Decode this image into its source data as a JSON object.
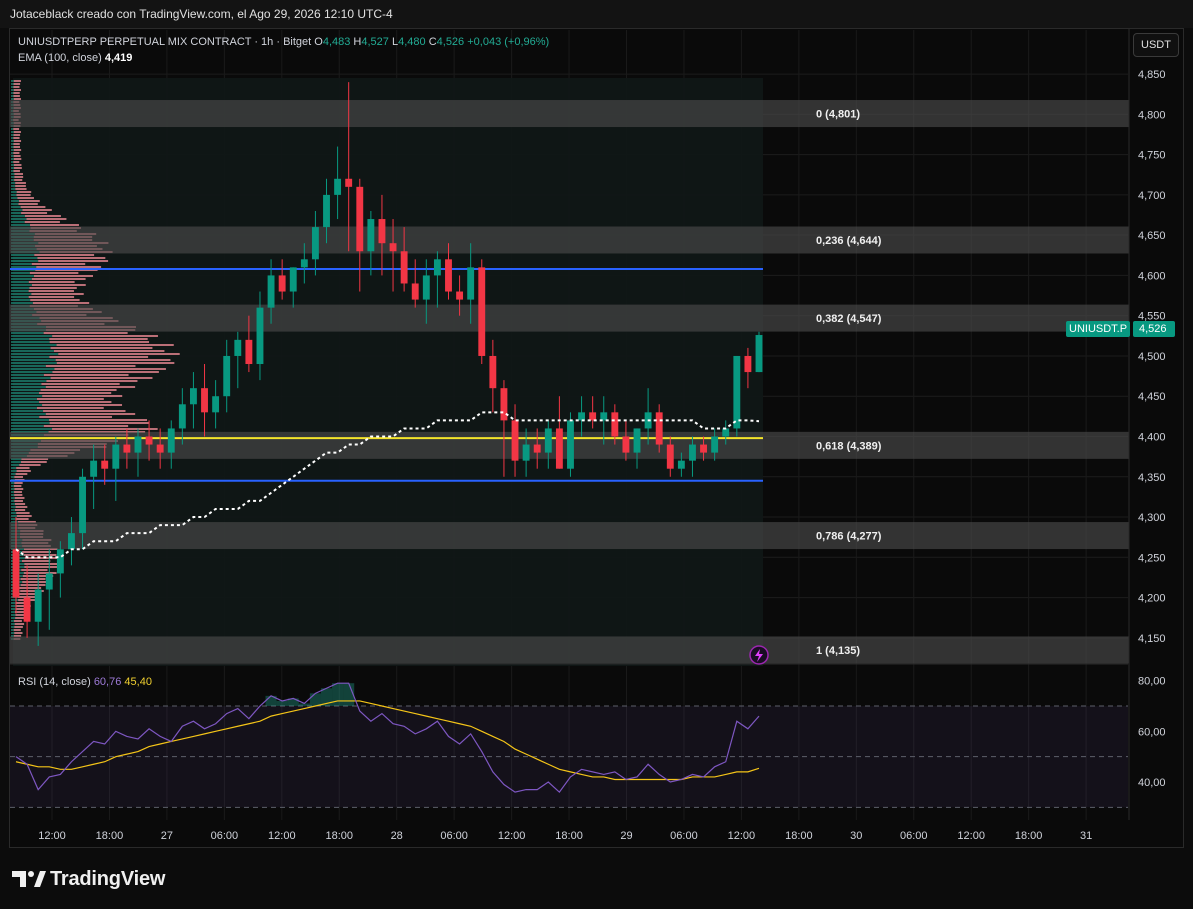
{
  "header": {
    "caption": "Jotaceblack creado con TradingView.com, el Ago 29, 2026 12:10 UTC-4"
  },
  "legend": {
    "symbol": "UNIUSDTPERP PERPETUAL MIX CONTRACT · 1h · Bitget",
    "o_label": "O",
    "o_value": "4,483",
    "h_label": "H",
    "h_value": "4,527",
    "l_label": "L",
    "l_value": "4,480",
    "c_label": "C",
    "c_value": "4,526",
    "change": "+0,043 (+0,96%)",
    "ema_label": "EMA (100, close)",
    "ema_value": "4,419",
    "rsi_label": "RSI (14, close)",
    "rsi_value": "60,76",
    "rsi_ma_value": "45,40"
  },
  "currency_button": "USDT",
  "price_tag": {
    "symbol": "UNIUSDT.P",
    "value": "4,526"
  },
  "branding": "TradingView",
  "colors": {
    "up": "#089981",
    "down": "#f23645",
    "ema": "#ffffff",
    "fib_band": "#4a4a4a",
    "support_line": "#2962ff",
    "poc_line": "#f5e52b",
    "rsi": "#7e57c2",
    "rsi_ma": "#f5c518",
    "volume_profile": "#f48d98",
    "volume_profile_up": "#1e8a78"
  },
  "chart_data": [
    {
      "type": "candlestick",
      "title": "UNIUSDTPERP PERPETUAL MIX CONTRACT · 1h · Bitget",
      "x_tick_labels": [
        "12:00",
        "18:00",
        "27",
        "06:00",
        "12:00",
        "18:00",
        "28",
        "06:00",
        "12:00",
        "18:00",
        "29",
        "06:00",
        "12:00",
        "18:00",
        "30",
        "06:00",
        "12:00",
        "18:00",
        "31"
      ],
      "y_tick_labels": [
        "4,850",
        "4,800",
        "4,750",
        "4,700",
        "4,650",
        "4,600",
        "4,550",
        "4,500",
        "4,450",
        "4,400",
        "4,350",
        "4,300",
        "4,250",
        "4,200",
        "4,150"
      ],
      "ylim": [
        4.12,
        4.865
      ],
      "candles_ohlc": [
        [
          4.26,
          4.3,
          4.18,
          4.2
        ],
        [
          4.2,
          4.24,
          4.15,
          4.17
        ],
        [
          4.17,
          4.23,
          4.14,
          4.21
        ],
        [
          4.21,
          4.26,
          4.16,
          4.23
        ],
        [
          4.23,
          4.27,
          4.2,
          4.26
        ],
        [
          4.26,
          4.3,
          4.24,
          4.28
        ],
        [
          4.28,
          4.36,
          4.26,
          4.35
        ],
        [
          4.35,
          4.39,
          4.31,
          4.37
        ],
        [
          4.37,
          4.39,
          4.34,
          4.36
        ],
        [
          4.36,
          4.4,
          4.32,
          4.39
        ],
        [
          4.39,
          4.41,
          4.36,
          4.38
        ],
        [
          4.38,
          4.41,
          4.35,
          4.4
        ],
        [
          4.4,
          4.42,
          4.37,
          4.39
        ],
        [
          4.39,
          4.41,
          4.36,
          4.38
        ],
        [
          4.38,
          4.42,
          4.36,
          4.41
        ],
        [
          4.41,
          4.46,
          4.39,
          4.44
        ],
        [
          4.44,
          4.48,
          4.41,
          4.46
        ],
        [
          4.46,
          4.49,
          4.4,
          4.43
        ],
        [
          4.43,
          4.47,
          4.41,
          4.45
        ],
        [
          4.45,
          4.52,
          4.43,
          4.5
        ],
        [
          4.5,
          4.53,
          4.46,
          4.52
        ],
        [
          4.52,
          4.55,
          4.48,
          4.49
        ],
        [
          4.49,
          4.58,
          4.47,
          4.56
        ],
        [
          4.56,
          4.62,
          4.54,
          4.6
        ],
        [
          4.6,
          4.62,
          4.57,
          4.58
        ],
        [
          4.58,
          4.61,
          4.56,
          4.61
        ],
        [
          4.61,
          4.64,
          4.59,
          4.62
        ],
        [
          4.62,
          4.68,
          4.6,
          4.66
        ],
        [
          4.66,
          4.72,
          4.64,
          4.7
        ],
        [
          4.7,
          4.76,
          4.67,
          4.72
        ],
        [
          4.72,
          4.84,
          4.63,
          4.71
        ],
        [
          4.71,
          4.72,
          4.58,
          4.63
        ],
        [
          4.63,
          4.68,
          4.6,
          4.67
        ],
        [
          4.67,
          4.7,
          4.6,
          4.64
        ],
        [
          4.64,
          4.67,
          4.58,
          4.63
        ],
        [
          4.63,
          4.66,
          4.58,
          4.59
        ],
        [
          4.59,
          4.62,
          4.56,
          4.57
        ],
        [
          4.57,
          4.62,
          4.54,
          4.6
        ],
        [
          4.6,
          4.63,
          4.56,
          4.62
        ],
        [
          4.62,
          4.64,
          4.57,
          4.58
        ],
        [
          4.58,
          4.6,
          4.55,
          4.57
        ],
        [
          4.57,
          4.64,
          4.54,
          4.61
        ],
        [
          4.61,
          4.62,
          4.49,
          4.5
        ],
        [
          4.5,
          4.52,
          4.43,
          4.46
        ],
        [
          4.46,
          4.47,
          4.35,
          4.42
        ],
        [
          4.42,
          4.44,
          4.35,
          4.37
        ],
        [
          4.37,
          4.41,
          4.35,
          4.39
        ],
        [
          4.39,
          4.41,
          4.36,
          4.38
        ],
        [
          4.38,
          4.42,
          4.36,
          4.41
        ],
        [
          4.41,
          4.45,
          4.36,
          4.36
        ],
        [
          4.36,
          4.43,
          4.35,
          4.42
        ],
        [
          4.42,
          4.45,
          4.4,
          4.43
        ],
        [
          4.43,
          4.45,
          4.41,
          4.42
        ],
        [
          4.42,
          4.45,
          4.39,
          4.43
        ],
        [
          4.43,
          4.44,
          4.39,
          4.4
        ],
        [
          4.4,
          4.42,
          4.37,
          4.38
        ],
        [
          4.38,
          4.41,
          4.36,
          4.41
        ],
        [
          4.41,
          4.46,
          4.39,
          4.43
        ],
        [
          4.43,
          4.44,
          4.38,
          4.39
        ],
        [
          4.39,
          4.4,
          4.35,
          4.36
        ],
        [
          4.36,
          4.38,
          4.35,
          4.37
        ],
        [
          4.37,
          4.4,
          4.35,
          4.39
        ],
        [
          4.39,
          4.4,
          4.37,
          4.38
        ],
        [
          4.38,
          4.41,
          4.37,
          4.4
        ],
        [
          4.4,
          4.42,
          4.39,
          4.41
        ],
        [
          4.41,
          4.5,
          4.4,
          4.5
        ],
        [
          4.5,
          4.51,
          4.46,
          4.48
        ],
        [
          4.48,
          4.53,
          4.48,
          4.526
        ]
      ],
      "ema_100": [
        4.26,
        4.25,
        4.25,
        4.25,
        4.25,
        4.26,
        4.26,
        4.27,
        4.27,
        4.27,
        4.28,
        4.28,
        4.28,
        4.29,
        4.29,
        4.29,
        4.3,
        4.3,
        4.31,
        4.31,
        4.31,
        4.32,
        4.32,
        4.33,
        4.34,
        4.35,
        4.36,
        4.37,
        4.38,
        4.38,
        4.39,
        4.39,
        4.4,
        4.4,
        4.4,
        4.41,
        4.41,
        4.41,
        4.42,
        4.42,
        4.42,
        4.42,
        4.43,
        4.43,
        4.43,
        4.42,
        4.42,
        4.42,
        4.42,
        4.42,
        4.42,
        4.42,
        4.42,
        4.42,
        4.42,
        4.42,
        4.42,
        4.42,
        4.42,
        4.42,
        4.42,
        4.42,
        4.41,
        4.41,
        4.41,
        4.42,
        4.42,
        4.419
      ],
      "fibonacci_levels": [
        {
          "ratio": 0,
          "price": 4.801,
          "label": "0 (4,801)"
        },
        {
          "ratio": 0.236,
          "price": 4.644,
          "label": "0,236 (4,644)"
        },
        {
          "ratio": 0.382,
          "price": 4.547,
          "label": "0,382 (4,547)"
        },
        {
          "ratio": 0.618,
          "price": 4.389,
          "label": "0,618 (4,389)"
        },
        {
          "ratio": 0.786,
          "price": 4.277,
          "label": "0,786 (4,277)"
        },
        {
          "ratio": 1,
          "price": 4.135,
          "label": "1 (4,135)"
        }
      ],
      "horizontal_lines": [
        {
          "price": 4.608,
          "color": "blue"
        },
        {
          "price": 4.398,
          "color": "yellow"
        },
        {
          "price": 4.345,
          "color": "blue"
        }
      ]
    },
    {
      "type": "line",
      "title": "RSI (14, close)",
      "y_tick_labels": [
        "80,00",
        "60,00",
        "40,00"
      ],
      "ylim": [
        25,
        85
      ],
      "levels": [
        70,
        50,
        30
      ],
      "series": [
        {
          "name": "RSI",
          "values": [
            50,
            47,
            37,
            42,
            43,
            48,
            52,
            56,
            55,
            60,
            58,
            57,
            61,
            58,
            56,
            62,
            64,
            61,
            63,
            67,
            69,
            65,
            70,
            74,
            72,
            73,
            71,
            75,
            77,
            79,
            79,
            68,
            64,
            67,
            63,
            62,
            59,
            61,
            64,
            58,
            55,
            59,
            52,
            44,
            39,
            36,
            37,
            37,
            40,
            36,
            42,
            45,
            44,
            43,
            44,
            41,
            42,
            47,
            43,
            40,
            41,
            43,
            42,
            46,
            48,
            64,
            61,
            66
          ]
        },
        {
          "name": "MA",
          "values": [
            48,
            47,
            46,
            46,
            45,
            45,
            46,
            47,
            48,
            50,
            51,
            52,
            54,
            55,
            56,
            57,
            58,
            59,
            60,
            61,
            62,
            63,
            64,
            66,
            67,
            68,
            69,
            70,
            71,
            72,
            72,
            72,
            71,
            70,
            69,
            68,
            67,
            66,
            65,
            64,
            63,
            62,
            60,
            58,
            56,
            53,
            51,
            49,
            47,
            45,
            44,
            43,
            42,
            42,
            41,
            41,
            41,
            41,
            41,
            41,
            41,
            42,
            42,
            42,
            43,
            44,
            44,
            45.4
          ]
        }
      ]
    }
  ]
}
